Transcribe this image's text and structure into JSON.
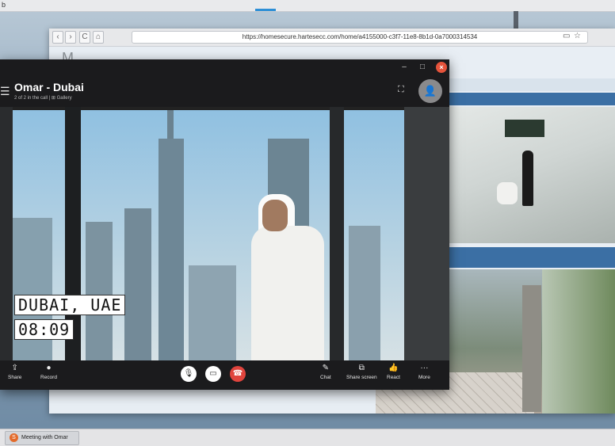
{
  "topbar": {
    "text": "b"
  },
  "browser": {
    "url": "https://homesecure.hartesecc.com/home/a4155000-c3f7-11e8-8b1d-0a7000314534",
    "logo": "M",
    "nav": {
      "back": "‹",
      "forward": "›",
      "reload": "C",
      "home": "⌂"
    },
    "icons": {
      "reader": "▭",
      "bookmark": "☆"
    }
  },
  "call": {
    "window_controls": {
      "minimize": "–",
      "maximize": "□",
      "close": "×"
    },
    "menu_icon": "☰",
    "title": "Omar - Dubai",
    "subtitle": "2 of 2 in the call | ⊞ Gallery",
    "fit_icon": "⛶",
    "add_person_icon": "👤",
    "video_overlay": {
      "location": "DUBAI, UAE",
      "time": "08:09"
    },
    "controls": {
      "share": "Share",
      "record": "Record",
      "chat": "Chat",
      "share_screen": "Share screen",
      "react": "React",
      "more": "More"
    },
    "control_icons": {
      "share": "⇪",
      "record": "●",
      "mic": "🎙",
      "video": "▭",
      "hangup": "☎",
      "chat": "✎",
      "share_screen": "⧉",
      "react": "👍",
      "more": "···"
    }
  },
  "taskbar": {
    "item_label": "Meeting with Omar"
  }
}
